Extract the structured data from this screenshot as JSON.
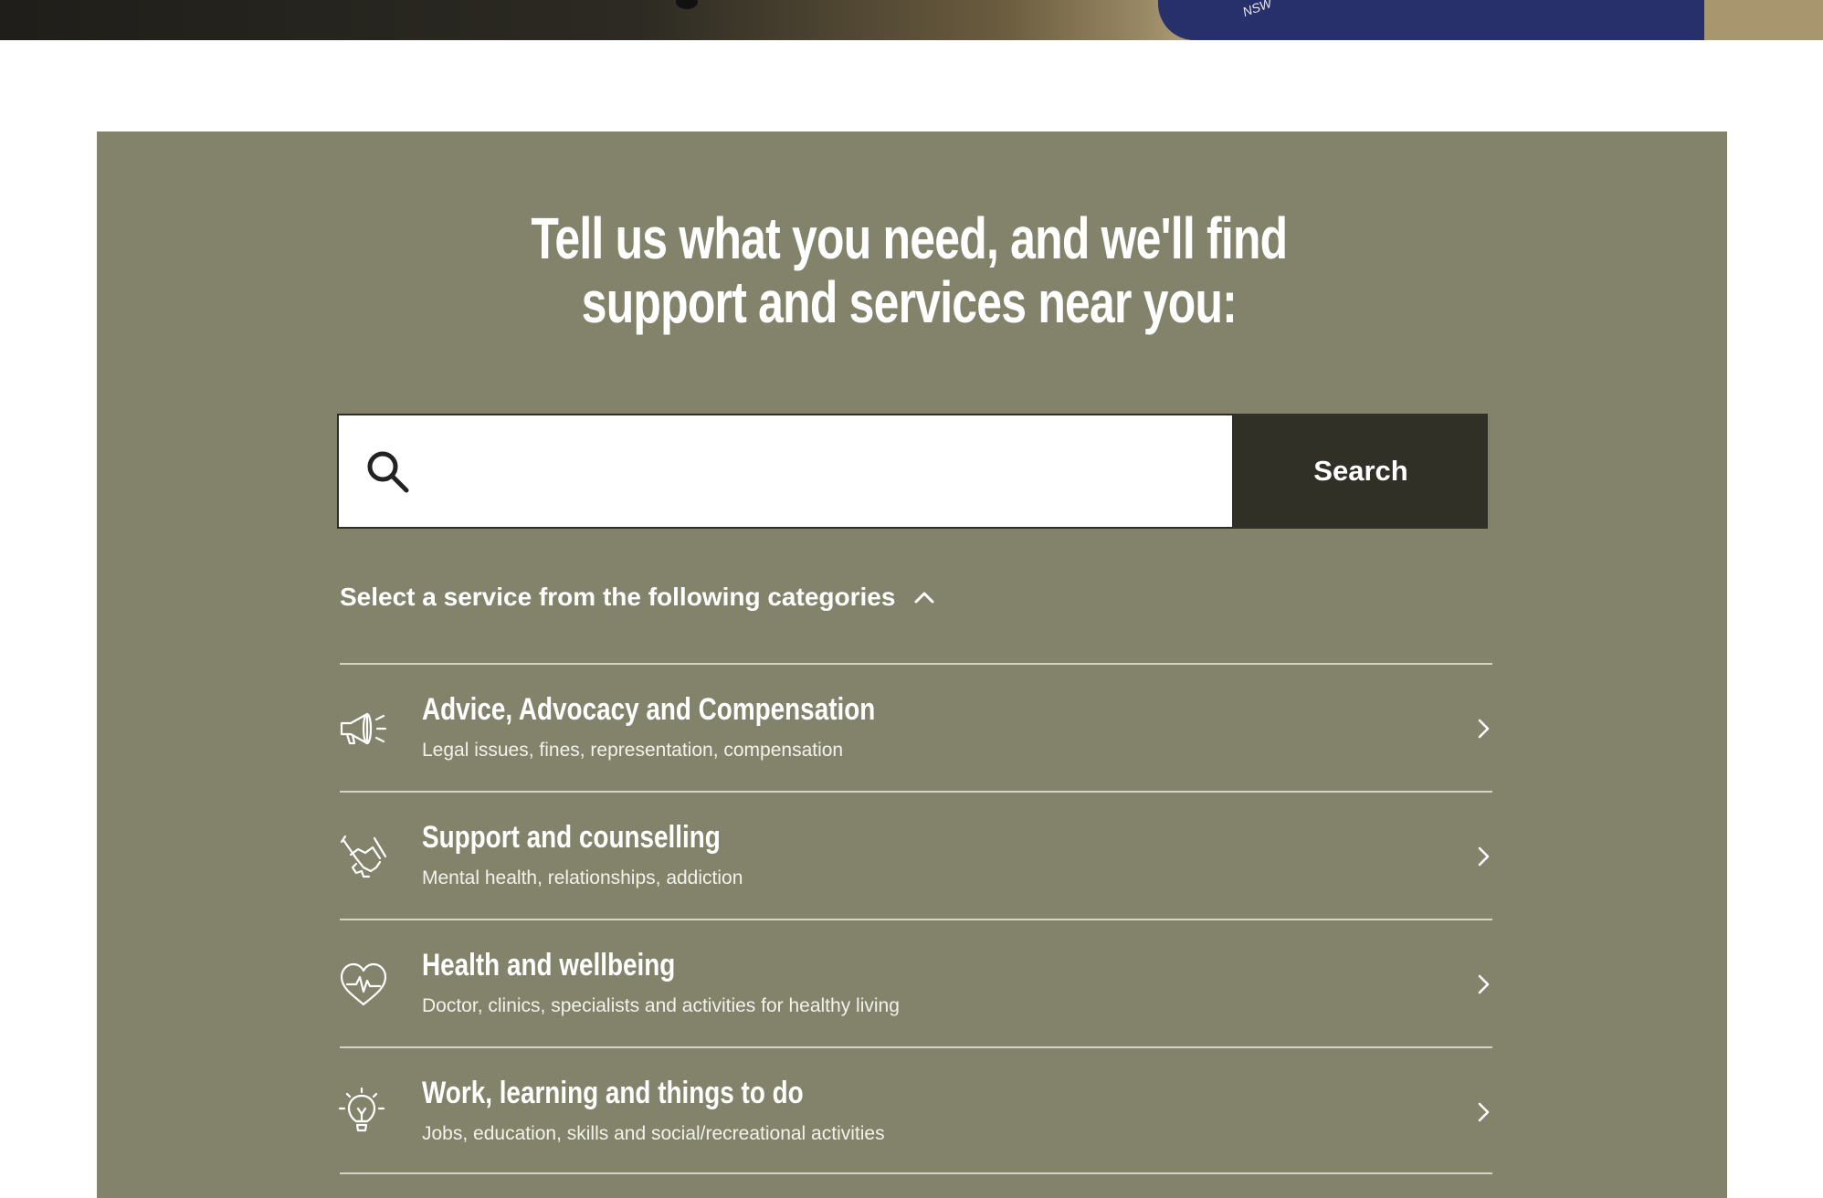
{
  "hero": {
    "shirt_text": "NSW"
  },
  "finder": {
    "heading_line1": "Tell us what you need, and we'll find",
    "heading_line2": "support and services near you:",
    "search": {
      "value": "",
      "placeholder": "",
      "button_label": "Search"
    },
    "categories_toggle_label": "Select a service from the following categories",
    "categories": [
      {
        "icon": "megaphone-icon",
        "title": "Advice, Advocacy and Compensation",
        "subtitle": "Legal issues, fines, representation, compensation"
      },
      {
        "icon": "handshake-icon",
        "title": "Support and counselling",
        "subtitle": "Mental health, relationships, addiction"
      },
      {
        "icon": "heart-pulse-icon",
        "title": "Health and wellbeing",
        "subtitle": "Doctor, clinics, specialists and activities for healthy living"
      },
      {
        "icon": "lightbulb-icon",
        "title": "Work, learning and things to do",
        "subtitle": "Jobs, education, skills and social/recreational activities"
      }
    ]
  },
  "colors": {
    "panel_bg": "#83836b",
    "button_bg": "#303026",
    "text": "#ffffff",
    "divider": "#d4d4c6"
  }
}
